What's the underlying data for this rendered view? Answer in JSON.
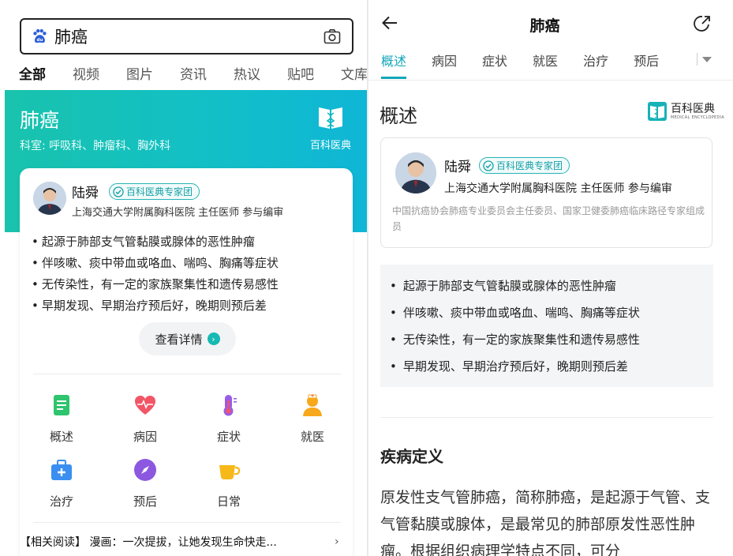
{
  "left": {
    "search": {
      "query": "肺癌"
    },
    "tabs": [
      "全部",
      "视频",
      "图片",
      "资讯",
      "热议",
      "贴吧",
      "文库"
    ],
    "banner": {
      "title": "肺癌",
      "department": "科室: 呼吸科、肿瘤科、胸外科",
      "logo_text": "百科医典"
    },
    "expert": {
      "name": "陆舜",
      "badge": "百科医典专家团",
      "title": "上海交通大学附属胸科医院 主任医师 参与编审"
    },
    "bullets": [
      "起源于肺部支气管黏膜或腺体的恶性肿瘤",
      "伴咳嗽、痰中带血或咯血、喘鸣、胸痛等症状",
      "无传染性，有一定的家族聚集性和遗传易感性",
      "早期发现、早期治疗预后好，晚期则预后差"
    ],
    "detail_button": "查看详情",
    "grid": [
      {
        "label": "概述",
        "icon": "document-icon",
        "color": "#2fc46e"
      },
      {
        "label": "病因",
        "icon": "heart-pulse-icon",
        "color": "#f25565"
      },
      {
        "label": "症状",
        "icon": "thermometer-icon",
        "color": "#9a5ce6"
      },
      {
        "label": "就医",
        "icon": "doctor-icon",
        "color": "#f7a81b"
      },
      {
        "label": "治疗",
        "icon": "medical-kit-icon",
        "color": "#3a8ff0"
      },
      {
        "label": "预后",
        "icon": "compass-icon",
        "color": "#8c58e0"
      },
      {
        "label": "日常",
        "icon": "cup-icon",
        "color": "#f7b81a"
      }
    ],
    "related": "【相关阅读】 漫画：一次提拔，让她发现生命快走..."
  },
  "right": {
    "title": "肺癌",
    "tabs": [
      "概述",
      "病因",
      "症状",
      "就医",
      "治疗",
      "预后"
    ],
    "section_title": "概述",
    "logo_text": "百科医典",
    "logo_subtext": "MEDICAL ENCYCLOPEDIA",
    "expert": {
      "name": "陆舜",
      "badge": "百科医典专家团",
      "title": "上海交通大学附属胸科医院 主任医师   参与编审",
      "description": "中国抗癌协会肺癌专业委员会主任委员、国家卫健委肺癌临床路径专家组成员"
    },
    "bullets": [
      "起源于肺部支气管黏膜或腺体的恶性肿瘤",
      "伴咳嗽、痰中带血或咯血、喘鸣、胸痛等症状",
      "无传染性，有一定的家族聚集性和遗传易感性",
      "早期发现、早期治疗预后好，晚期则预后差"
    ],
    "definition_title": "疾病定义",
    "definition_text": "原发性支气管肺癌，简称肺癌，是起源于气管、支气管黏膜或腺体，是最常见的肺部原发性恶性肿瘤。根据组织病理学特点不同，可分"
  },
  "colors": {
    "accent": "#13a6b8",
    "banner_start": "#19c3ad",
    "banner_end": "#0fb6d6"
  }
}
